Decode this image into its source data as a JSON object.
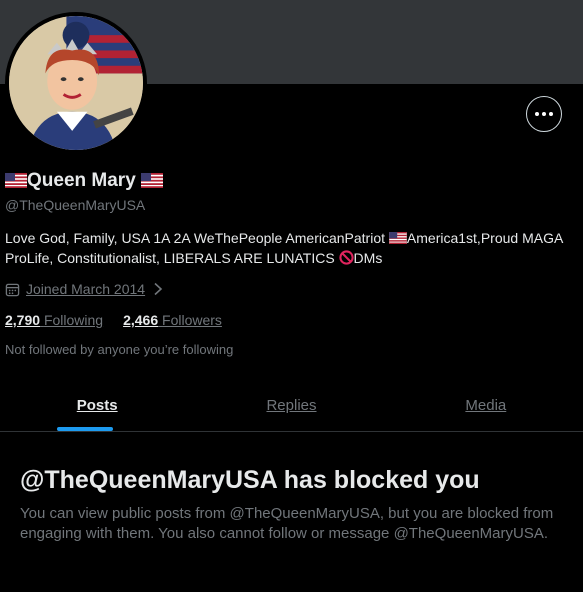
{
  "profile": {
    "name": "Queen Mary",
    "handle": "@TheQueenMaryUSA",
    "bio_part1": "Love God, Family, USA 1A 2A WeThePeople AmericanPatriot ",
    "bio_part2": "America1st,Proud MAGA ProLife, Constitutionalist, LIBERALS ARE LUNATICS ",
    "bio_part3": "DMs",
    "joined": "Joined March 2014",
    "following_count": "2,790",
    "following_label": "Following",
    "followers_count": "2,466",
    "followers_label": "Followers",
    "not_followed": "Not followed by anyone you’re following"
  },
  "icons": {
    "more": "more-horizontal-icon",
    "calendar": "calendar-icon",
    "chevron": "chevron-right-icon",
    "flag": "us-flag-icon",
    "prohibited": "prohibited-icon"
  },
  "tabs": [
    {
      "label": "Posts",
      "active": true
    },
    {
      "label": "Replies",
      "active": false
    },
    {
      "label": "Media",
      "active": false
    }
  ],
  "blocked": {
    "title": "@TheQueenMaryUSA has blocked you",
    "body": "You can view public posts from @TheQueenMaryUSA, but you are blocked from engaging with them. You also cannot follow or message @TheQueenMaryUSA."
  },
  "colors": {
    "background": "#000000",
    "banner": "#333639",
    "accent": "#1d9bf0",
    "muted": "#71767b",
    "text": "#e7e9ea"
  }
}
